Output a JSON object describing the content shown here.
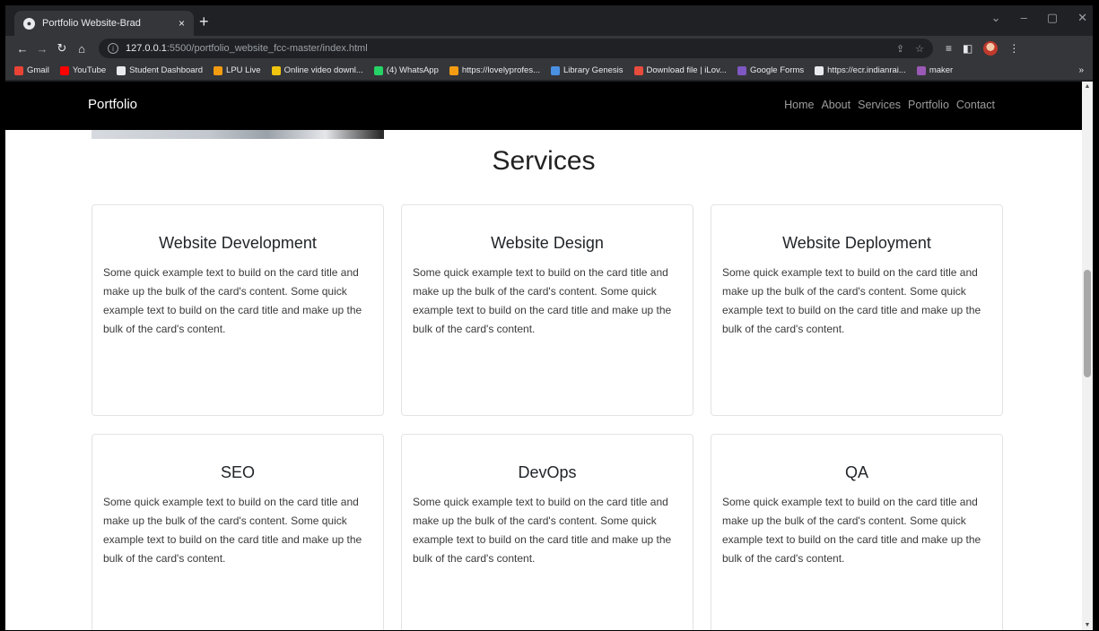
{
  "browser": {
    "tab_title": "Portfolio Website-Brad",
    "tab_close": "×",
    "new_tab": "+",
    "url_host": "127.0.0.1",
    "url_path": ":5500/portfolio_website_fcc-master/index.html",
    "bookmarks": [
      {
        "label": "Gmail",
        "color": "#ea4335"
      },
      {
        "label": "YouTube",
        "color": "#ff0000"
      },
      {
        "label": "Student Dashboard",
        "color": "#e8eaed"
      },
      {
        "label": "LPU Live",
        "color": "#f39c12"
      },
      {
        "label": "Online video downl...",
        "color": "#f1c40f"
      },
      {
        "label": "(4) WhatsApp",
        "color": "#25d366"
      },
      {
        "label": "https://lovelyprofes...",
        "color": "#f39c12"
      },
      {
        "label": "Library Genesis",
        "color": "#4a90e2"
      },
      {
        "label": "Download file | iLov...",
        "color": "#e74c3c"
      },
      {
        "label": "Google Forms",
        "color": "#7e57c2"
      },
      {
        "label": "https://ecr.indianrai...",
        "color": "#e8eaed"
      },
      {
        "label": "maker",
        "color": "#9b59b6"
      }
    ],
    "bookmarks_more": "»"
  },
  "page": {
    "brand": "Portfolio",
    "nav": [
      "Home",
      "About",
      "Services",
      "Portfolio",
      "Contact"
    ],
    "section_title": "Services",
    "cards": [
      {
        "title": "Website Development",
        "text": "Some quick example text to build on the card title and make up the bulk of the card's content. Some quick example text to build on the card title and make up the bulk of the card's content."
      },
      {
        "title": "Website Design",
        "text": "Some quick example text to build on the card title and make up the bulk of the card's content. Some quick example text to build on the card title and make up the bulk of the card's content."
      },
      {
        "title": "Website Deployment",
        "text": "Some quick example text to build on the card title and make up the bulk of the card's content. Some quick example text to build on the card title and make up the bulk of the card's content."
      },
      {
        "title": "SEO",
        "text": "Some quick example text to build on the card title and make up the bulk of the card's content. Some quick example text to build on the card title and make up the bulk of the card's content."
      },
      {
        "title": "DevOps",
        "text": "Some quick example text to build on the card title and make up the bulk of the card's content. Some quick example text to build on the card title and make up the bulk of the card's content."
      },
      {
        "title": "QA",
        "text": "Some quick example text to build on the card title and make up the bulk of the card's content. Some quick example text to build on the card title and make up the bulk of the card's content."
      }
    ]
  }
}
